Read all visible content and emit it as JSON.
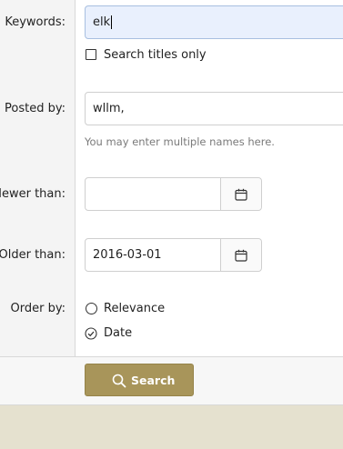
{
  "form": {
    "keywords": {
      "label": "Keywords:",
      "value": "elk"
    },
    "titles_only": {
      "label": "Search titles only",
      "checked": false
    },
    "posted_by": {
      "label": "Posted by:",
      "value": "wllm,",
      "hint": "You may enter multiple names here."
    },
    "newer_than": {
      "label": "Newer than:",
      "value": ""
    },
    "older_than": {
      "label": "Older than:",
      "value": "2016-03-01"
    },
    "order_by": {
      "label": "Order by:",
      "options": [
        {
          "label": "Relevance",
          "selected": false
        },
        {
          "label": "Date",
          "selected": true
        }
      ]
    }
  },
  "actions": {
    "search_label": "Search"
  },
  "icons": {
    "calendar": "calendar-icon",
    "search": "search-icon",
    "radio_checked": "check-circle-icon"
  },
  "colors": {
    "accent": "#a8955a",
    "focus_bg": "#e9f0fd",
    "page_bg": "#e5e1cf"
  }
}
